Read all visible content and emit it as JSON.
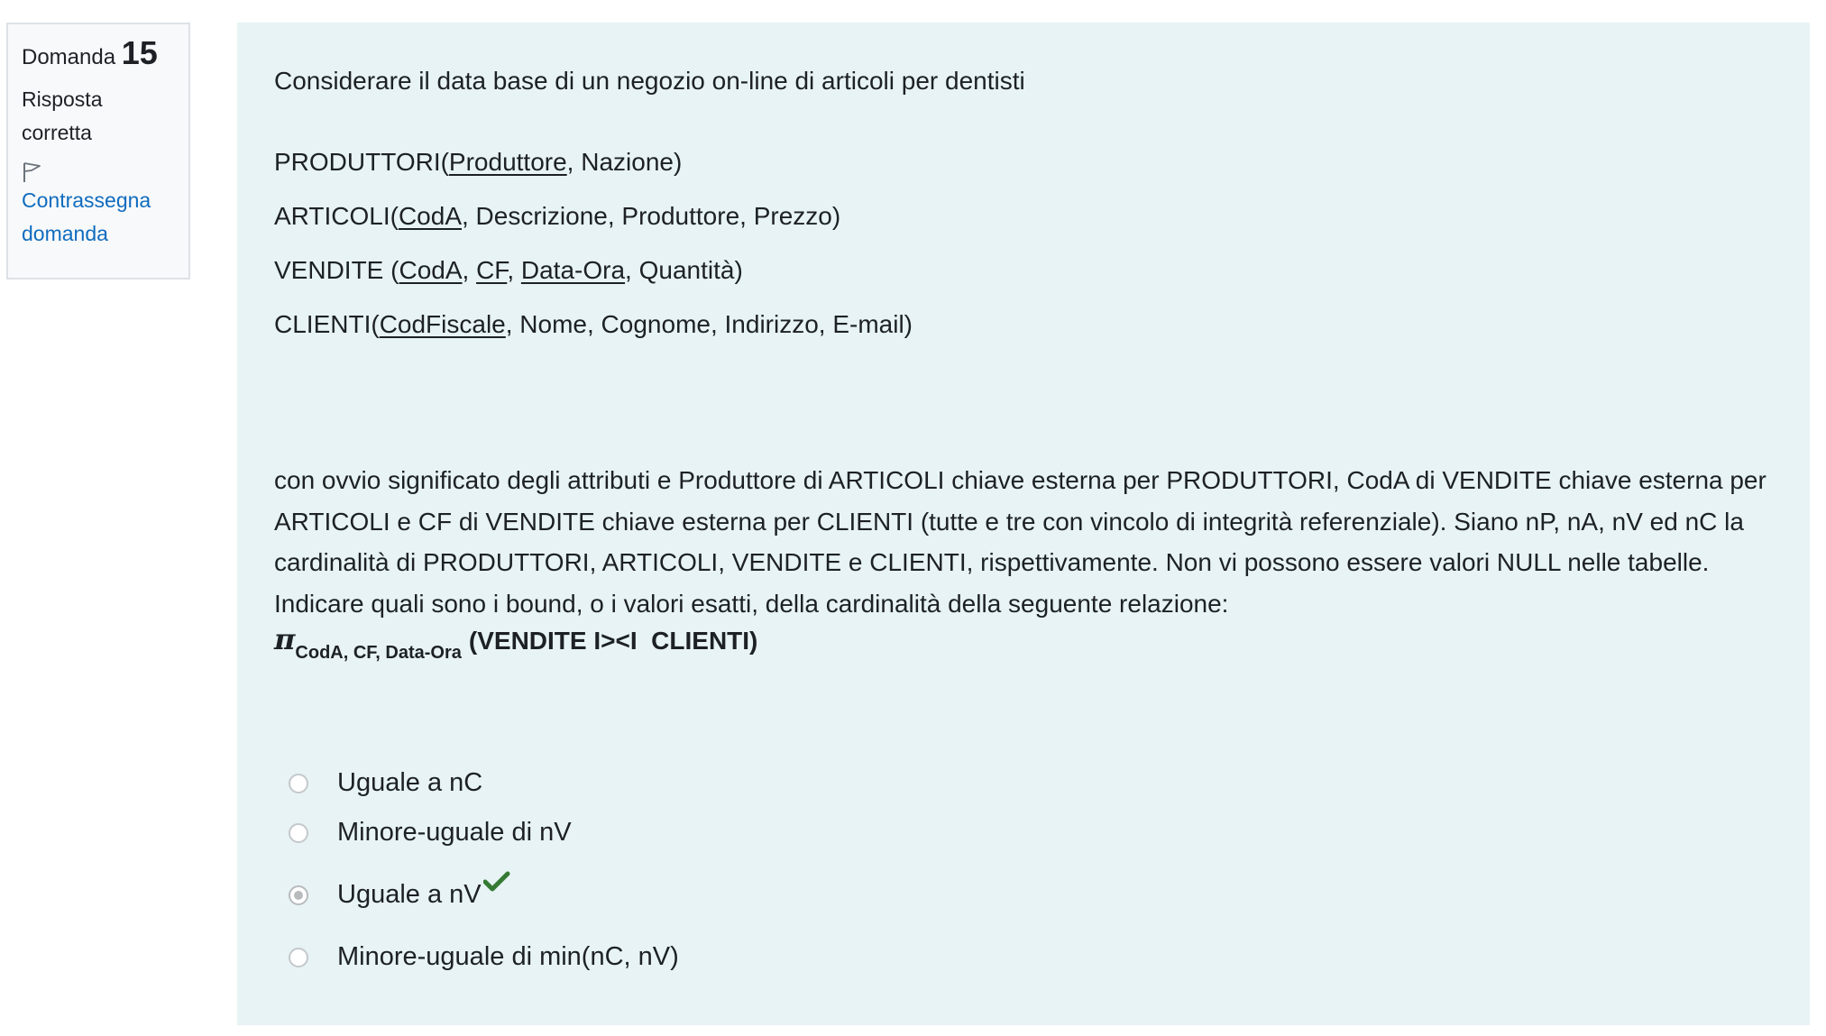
{
  "info": {
    "question_label": "Domanda",
    "question_number": "15",
    "state_line1": "Risposta",
    "state_line2": "corretta",
    "flag_line1": "Contrassegna",
    "flag_line2": "domanda"
  },
  "question": {
    "intro": "Considerare il data base di un negozio on-line di articoli per dentisti",
    "schema": {
      "produttori": {
        "name": "PRODUTTORI(",
        "key": "Produttore",
        "rest": ", Nazione)"
      },
      "articoli": {
        "name": "ARTICOLI(",
        "key": "CodA",
        "rest": ", Descrizione, Produttore, Prezzo)"
      },
      "vendite": {
        "name": "VENDITE (",
        "key1": "CodA",
        "sep1": ", ",
        "key2": "CF",
        "sep2": ", ",
        "key3": "Data-Ora",
        "rest": ", Quantità)"
      },
      "clienti": {
        "name": "CLIENTI(",
        "key": "CodFiscale",
        "rest": ", Nome, Cognome, Indirizzo, E-mail)"
      }
    },
    "paragraph": "con ovvio significato degli attributi e Produttore di ARTICOLI chiave esterna per PRODUTTORI, CodA di VENDITE chiave esterna per ARTICOLI e CF di VENDITE chiave esterna per CLIENTI (tutte e tre con vincolo di integrità referenziale). Siano nP, nA, nV ed nC la cardinalità di PRODUTTORI, ARTICOLI, VENDITE e CLIENTI, rispettivamente. Non vi possono essere valori NULL nelle tabelle. Indicare quali sono i bound, o i valori esatti, della cardinalità della seguente relazione:",
    "formula": {
      "symbol": "π",
      "subscript": "CodA, CF, Data-Ora",
      "expression": "(VENDITE I><I  CLIENTI)"
    }
  },
  "answers": [
    {
      "label": "Uguale a nC",
      "selected": false
    },
    {
      "label": "Minore-uguale di nV",
      "selected": false
    },
    {
      "label": "Uguale a nV",
      "selected": true,
      "correct": true
    },
    {
      "label": "Minore-uguale di min(nC, nV)",
      "selected": false
    }
  ],
  "colors": {
    "content_bg": "#e7f3f5",
    "info_bg": "#f8f9fa",
    "link": "#0f6cbf",
    "correct_tick": "#357a32"
  },
  "icons": {
    "flag": "flag-icon",
    "correct": "check-icon"
  }
}
